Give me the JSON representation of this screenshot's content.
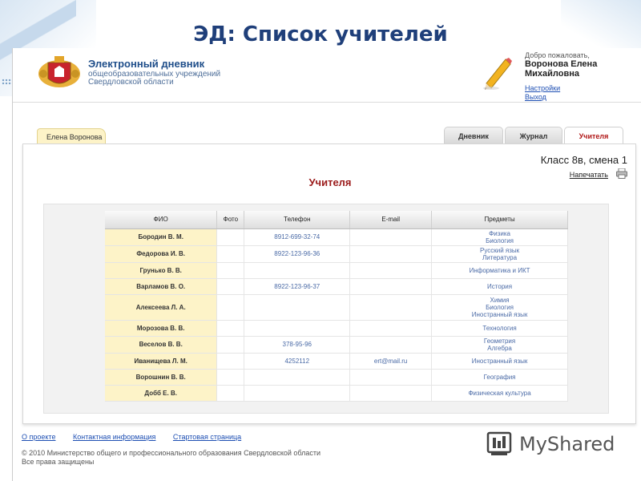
{
  "slide": {
    "title": "ЭД: Список учителей"
  },
  "header": {
    "site_name": "Электронный дневник",
    "site_sub1": "общеобразовательных учреждений",
    "site_sub2": "Свердловской области",
    "welcome": "Добро пожаловать,",
    "user_line1": "Воронова Елена",
    "user_line2": "Михайловна",
    "settings": "Настройки",
    "exit": "Выход",
    "icons": [
      "coat-of-arms-logo",
      "pencil-icon"
    ]
  },
  "tabs": {
    "user_tab": "Елена Воронова",
    "items": [
      {
        "label": "Дневник",
        "active": false
      },
      {
        "label": "Журнал",
        "active": false
      },
      {
        "label": "Учителя",
        "active": true
      }
    ],
    "active_color": "#b01616"
  },
  "main": {
    "class_title": "Класс 8в, смена 1",
    "print_label": "Напечатать",
    "section_title": "Учителя",
    "columns": [
      "ФИО",
      "Фото",
      "Телефон",
      "E-mail",
      "Предметы"
    ],
    "rows": [
      {
        "fio": "Бородин В. М.",
        "photo": "",
        "phone": "8912-699-32-74",
        "email": "",
        "subjects": [
          "Физика",
          "Биология"
        ]
      },
      {
        "fio": "Федорова И. В.",
        "photo": "",
        "phone": "8922-123-96-36",
        "email": "",
        "subjects": [
          "Русский язык",
          "Литература"
        ]
      },
      {
        "fio": "Грунько В. В.",
        "photo": "",
        "phone": "",
        "email": "",
        "subjects": [
          "Информатика и ИКТ"
        ]
      },
      {
        "fio": "Варламов В. О.",
        "photo": "",
        "phone": "8922-123-96-37",
        "email": "",
        "subjects": [
          "История"
        ]
      },
      {
        "fio": "Алексеева Л. А.",
        "photo": "",
        "phone": "",
        "email": "",
        "subjects": [
          "Химия",
          "Биология",
          "Иностранный язык"
        ]
      },
      {
        "fio": "Морозова В. В.",
        "photo": "",
        "phone": "",
        "email": "",
        "subjects": [
          "Технология"
        ]
      },
      {
        "fio": "Веселов В. В.",
        "photo": "",
        "phone": "378-95-96",
        "email": "",
        "subjects": [
          "Геометрия",
          "Алгебра"
        ]
      },
      {
        "fio": "Иванищева Л. М.",
        "photo": "",
        "phone": "4252112",
        "email": "ert@mail.ru",
        "subjects": [
          "Иностранный язык"
        ]
      },
      {
        "fio": "Ворошнин В. В.",
        "photo": "",
        "phone": "",
        "email": "",
        "subjects": [
          "География"
        ]
      },
      {
        "fio": "Добб Е. В.",
        "photo": "",
        "phone": "",
        "email": "",
        "subjects": [
          "Физическая культура"
        ]
      }
    ]
  },
  "footer": {
    "links": [
      "О проекте",
      "Контактная информация",
      "Стартовая страница"
    ],
    "copyright1": "© 2010 Министерство общего и профессионального образования Свердловской области",
    "copyright2": "Все права защищены"
  },
  "watermark": {
    "text": "MyShared"
  },
  "colors": {
    "title": "#1f3f7a",
    "section": "#9b1b1b",
    "link": "#1e4fb3",
    "fio_bg": "#fdf3c8"
  }
}
